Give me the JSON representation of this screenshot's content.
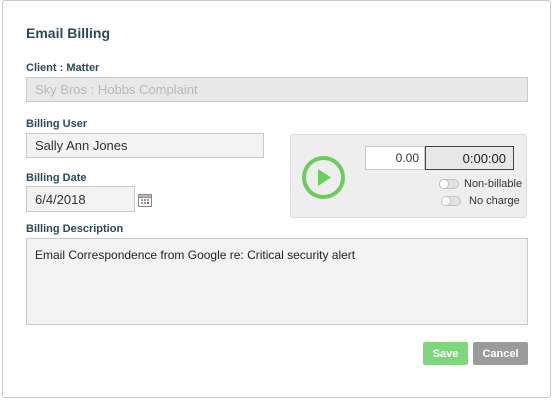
{
  "dialog": {
    "title": "Email Billing"
  },
  "client_matter": {
    "label": "Client : Matter",
    "value": "Sky Bros : Hobbs Complaint"
  },
  "billing_user": {
    "label": "Billing User",
    "value": "Sally Ann Jones"
  },
  "billing_date": {
    "label": "Billing Date",
    "value": "6/4/2018"
  },
  "timer": {
    "hours": "0.00",
    "elapsed": "0:00:00",
    "non_billable_label": "Non-billable",
    "non_billable_on": false,
    "no_charge_label": "No charge",
    "no_charge_on": false,
    "play_icon": "play-icon",
    "accent_color": "#6cce5a"
  },
  "billing_description": {
    "label": "Billing Description",
    "value": "Email Correspondence from Google re: Critical security alert"
  },
  "actions": {
    "save_label": "Save",
    "cancel_label": "Cancel",
    "save_color": "#7ed77a",
    "cancel_color": "#9b9b9b"
  }
}
